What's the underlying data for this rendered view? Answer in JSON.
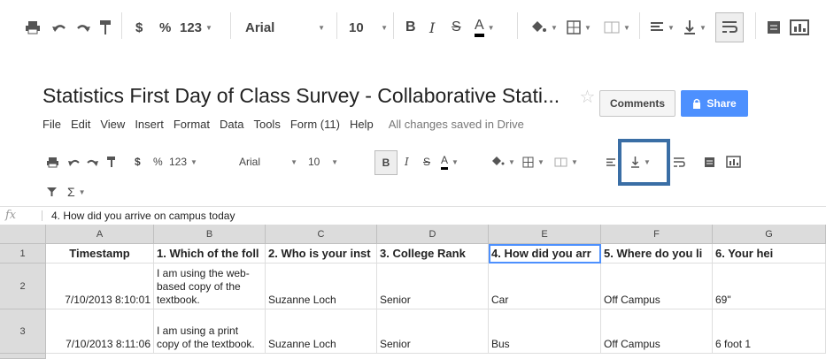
{
  "toolbar": {
    "currency": "$",
    "percent": "%",
    "number_format": "123",
    "font": "Arial",
    "font_size": "10",
    "bold": "B",
    "italic": "I",
    "strike": "S",
    "text_color": "A",
    "sum": "Σ"
  },
  "doc": {
    "title": "Statistics First Day of Class Survey - Collaborative Stati...",
    "menu": [
      "File",
      "Edit",
      "View",
      "Insert",
      "Format",
      "Data",
      "Tools",
      "Form (11)",
      "Help"
    ],
    "save_status": "All changes saved in Drive",
    "comments_label": "Comments",
    "share_label": "Share"
  },
  "formula_bar": {
    "fx": "fx",
    "value": "4. How did you arrive on campus today"
  },
  "grid": {
    "columns": [
      "A",
      "B",
      "C",
      "D",
      "E",
      "F",
      "G"
    ],
    "rows": [
      {
        "num": "1",
        "cells": [
          "Timestamp",
          "1. Which of the foll",
          "2. Who is your inst",
          "3. College Rank",
          "4. How did you arr",
          "5. Where do you li",
          "6. Your hei"
        ]
      },
      {
        "num": "2",
        "cells": [
          "7/10/2013 8:10:01",
          "I am using the web-based copy of the textbook.",
          "Suzanne Loch",
          "Senior",
          "Car",
          "Off Campus",
          "69\""
        ]
      },
      {
        "num": "3",
        "cells": [
          "7/10/2013 8:11:06",
          "I am using a print copy of the textbook.",
          "Suzanne Loch",
          "Senior",
          "Bus",
          "Off Campus",
          "6 foot 1"
        ]
      }
    ]
  },
  "colors": {
    "share_blue": "#4d90fe",
    "highlight_box": "#3a6ea5",
    "selection": "#4d90fe"
  }
}
